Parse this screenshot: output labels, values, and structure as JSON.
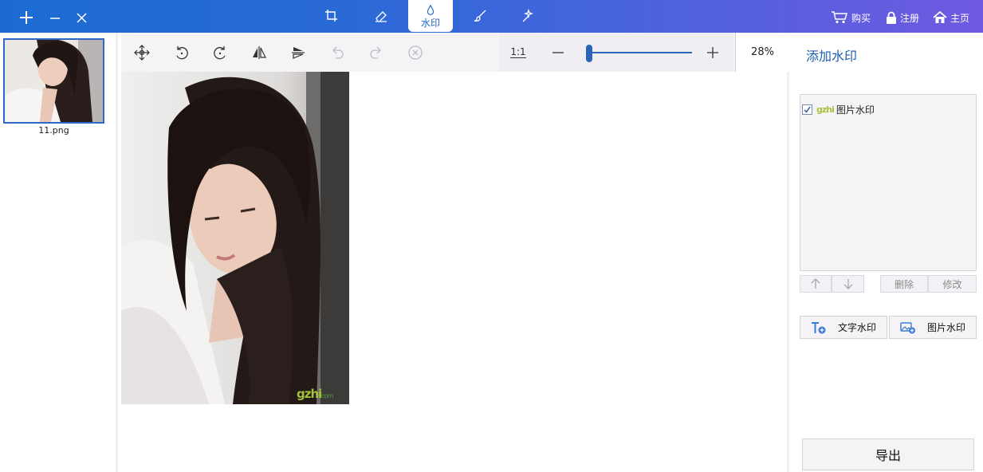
{
  "window": {
    "add_icon": "plus-icon",
    "minimize_icon": "minus-icon",
    "close_icon": "close-icon"
  },
  "tools": [
    {
      "name": "crop",
      "icon": "crop-icon",
      "label": ""
    },
    {
      "name": "erase",
      "icon": "eraser-icon",
      "label": ""
    },
    {
      "name": "watermark",
      "icon": "drop-icon",
      "label": "水印",
      "active": true
    },
    {
      "name": "brush",
      "icon": "brush-icon",
      "label": ""
    },
    {
      "name": "magic",
      "icon": "wand-icon",
      "label": ""
    }
  ],
  "top_links": {
    "buy": "购买",
    "register": "注册",
    "home": "主页"
  },
  "thumbnails": [
    {
      "file_name": "11.png",
      "selected": true
    }
  ],
  "toolbar": {
    "actual_size_label": "1:1",
    "zoom_percent": "28%",
    "zoom_slider_fraction": 0.03
  },
  "canvas": {
    "watermark_text": "gzhi",
    "watermark_sub": "com"
  },
  "right_panel": {
    "title": "添加水印",
    "watermark_list": [
      {
        "checked": true,
        "logo_text": "gzhi",
        "label": "图片水印"
      }
    ],
    "delete_label": "删除",
    "edit_label": "修改",
    "text_watermark_label": "文字水印",
    "image_watermark_label": "图片水印",
    "export_label": "导出"
  },
  "colors": {
    "accent": "#2a66b8",
    "topbar_start": "#1c6bd4",
    "topbar_end": "#6f59e0"
  }
}
